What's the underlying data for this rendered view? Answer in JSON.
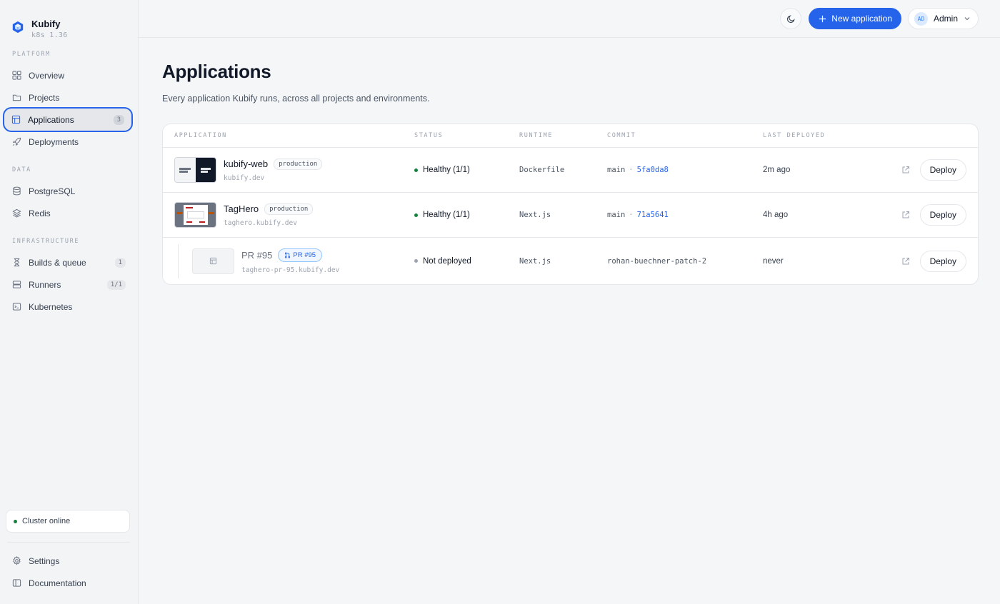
{
  "brand": {
    "name": "Kubify",
    "version": "k8s 1.36"
  },
  "sidebar": {
    "sections": [
      {
        "label": "PLATFORM"
      },
      {
        "label": "DATA"
      },
      {
        "label": "INFRASTRUCTURE"
      }
    ],
    "items": [
      {
        "label": "Overview",
        "icon": "grid-icon"
      },
      {
        "label": "Projects",
        "icon": "folder-icon"
      },
      {
        "label": "Applications",
        "icon": "layout-icon",
        "badge": "3",
        "active": true
      },
      {
        "label": "Deployments",
        "icon": "rocket-icon"
      },
      {
        "label": "PostgreSQL",
        "icon": "database-icon"
      },
      {
        "label": "Redis",
        "icon": "layers-icon"
      },
      {
        "label": "Builds & queue",
        "icon": "hourglass-icon",
        "badge": "1"
      },
      {
        "label": "Runners",
        "icon": "server-icon",
        "badge": "1/1"
      },
      {
        "label": "Kubernetes",
        "icon": "terminal-icon"
      }
    ],
    "cluster_status": "Cluster online",
    "footer": [
      {
        "label": "Settings",
        "icon": "gear-icon"
      },
      {
        "label": "Documentation",
        "icon": "book-icon"
      }
    ]
  },
  "topbar": {
    "new_app_label": "New application",
    "user_initials": "AD",
    "user_name": "Admin"
  },
  "page": {
    "title": "Applications",
    "subtitle": "Every application Kubify runs, across all projects and environments."
  },
  "table": {
    "headers": {
      "application": "APPLICATION",
      "status": "STATUS",
      "runtime": "RUNTIME",
      "commit": "COMMIT",
      "last_deployed": "LAST DEPLOYED"
    },
    "rows": [
      {
        "name": "kubify-web",
        "env": "production",
        "host": "kubify.dev",
        "status": "Healthy (1/1)",
        "runtime": "Dockerfile",
        "branch": "main",
        "sha": "5fa0da8",
        "last": "2m ago",
        "deploy": "Deploy"
      },
      {
        "name": "TagHero",
        "env": "production",
        "host": "taghero.kubify.dev",
        "status": "Healthy (1/1)",
        "runtime": "Next.js",
        "branch": "main",
        "sha": "71a5641",
        "last": "4h ago",
        "deploy": "Deploy"
      },
      {
        "name": "PR #95",
        "env": "PR #95",
        "host": "taghero-pr-95.kubify.dev",
        "status": "Not deployed",
        "runtime": "Next.js",
        "branch": "rohan-buechner-patch-2",
        "sha": "",
        "last": "never",
        "deploy": "Deploy"
      }
    ]
  },
  "colors": {
    "accent": "#2563eb",
    "healthy": "#15803d",
    "inactive": "#9ca3af"
  }
}
